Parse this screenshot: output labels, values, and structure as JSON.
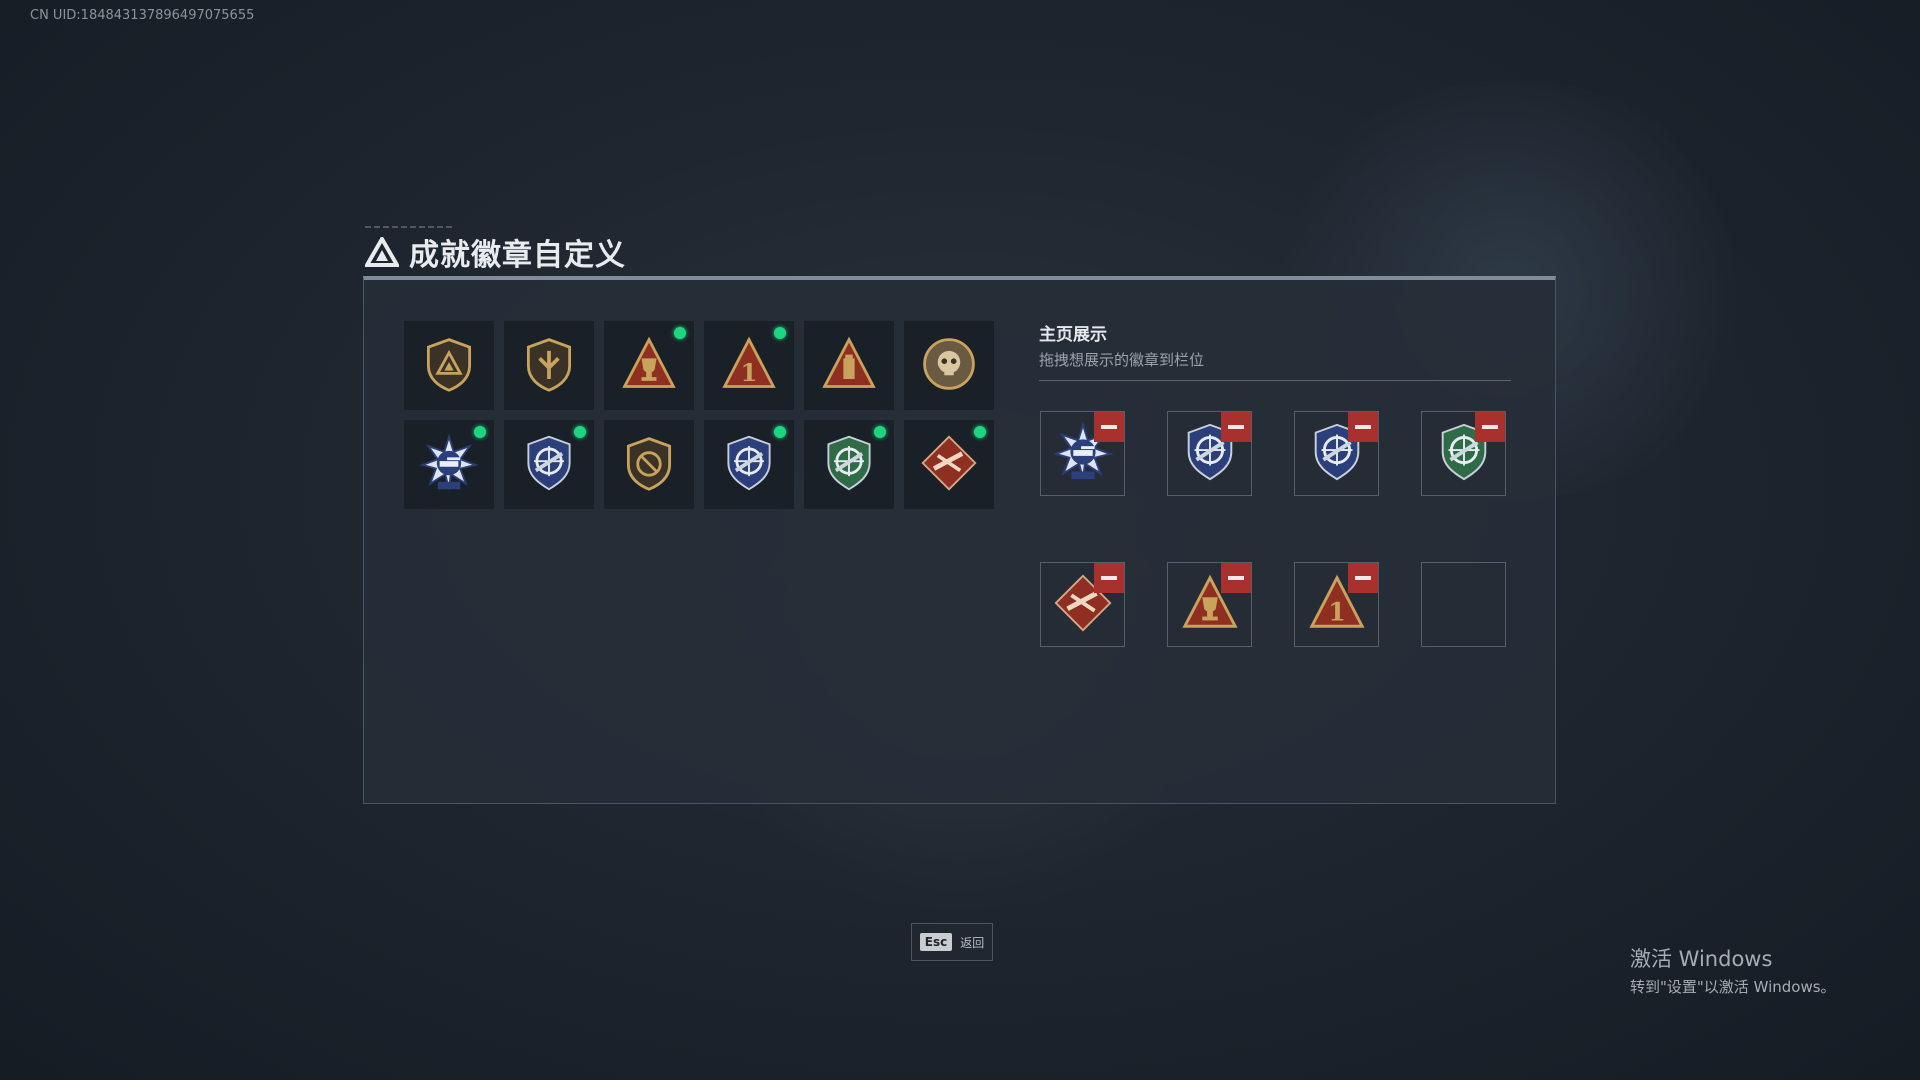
{
  "uid_text": "CN UID:1848431378964970756​55",
  "title": "成就徽章自定义",
  "showcase": {
    "title": "主页展示",
    "subtitle": "拖拽想展示的徽章到栏位"
  },
  "badges": [
    {
      "icon": "triangle-shield-badge-icon",
      "new": false
    },
    {
      "icon": "arrow-shield-badge-icon",
      "new": false
    },
    {
      "icon": "trophy-triangle-badge-icon",
      "new": true
    },
    {
      "icon": "number-one-triangle-badge-icon",
      "new": true
    },
    {
      "icon": "fortress-triangle-badge-icon",
      "new": false
    },
    {
      "icon": "skull-coin-badge-icon",
      "new": false
    },
    {
      "icon": "tank-star-badge-icon",
      "new": true
    },
    {
      "icon": "crosshair-navy-badge-icon",
      "new": true
    },
    {
      "icon": "crossed-shield-badge-icon",
      "new": false
    },
    {
      "icon": "crosshair-blue-badge-icon",
      "new": true
    },
    {
      "icon": "crosshair-green-badge-icon",
      "new": true
    },
    {
      "icon": "rifle-diamond-badge-icon",
      "new": true
    }
  ],
  "slots": [
    {
      "icon": "tank-star-badge-icon",
      "filled": true
    },
    {
      "icon": "crosshair-navy-badge-icon",
      "filled": true
    },
    {
      "icon": "crosshair-blue-badge-icon",
      "filled": true
    },
    {
      "icon": "crosshair-green-badge-icon",
      "filled": true
    },
    {
      "icon": "rifle-diamond-badge-icon",
      "filled": true
    },
    {
      "icon": "trophy-triangle-badge-icon",
      "filled": true
    },
    {
      "icon": "number-one-triangle-badge-icon",
      "filled": true
    },
    {
      "icon": "empty-slot",
      "filled": false
    }
  ],
  "esc": {
    "key": "Esc",
    "label": "返回"
  },
  "watermark": {
    "title": "激活 Windows",
    "subtitle": "转到\"设置\"以激活 Windows。"
  },
  "colors": {
    "new_dot": "#1ed67f",
    "remove": "#a8312e",
    "gold": "#c9a35c",
    "navy": "#2b3f7a",
    "green": "#2f6b45",
    "red": "#8e2f22"
  }
}
